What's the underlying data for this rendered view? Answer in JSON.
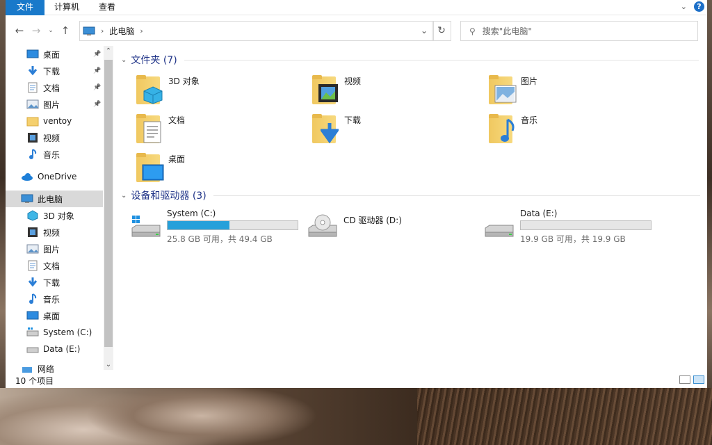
{
  "ribbon": {
    "tabs": [
      "文件",
      "计算机",
      "查看"
    ]
  },
  "address": {
    "location": "此电脑",
    "search_placeholder": "搜索\"此电脑\""
  },
  "nav": {
    "quick": [
      {
        "label": "桌面",
        "icon": "desktop-icon",
        "pinned": true
      },
      {
        "label": "下载",
        "icon": "download-icon",
        "pinned": true
      },
      {
        "label": "文档",
        "icon": "document-icon",
        "pinned": true
      },
      {
        "label": "图片",
        "icon": "picture-icon",
        "pinned": true
      },
      {
        "label": "ventoy",
        "icon": "folder-icon",
        "pinned": false
      },
      {
        "label": "视频",
        "icon": "video-icon",
        "pinned": false
      },
      {
        "label": "音乐",
        "icon": "music-icon",
        "pinned": false
      }
    ],
    "onedrive": "OneDrive",
    "thispc": "此电脑",
    "pc_children": [
      {
        "label": "3D 对象",
        "icon": "3d-objects-icon"
      },
      {
        "label": "视频",
        "icon": "video-icon"
      },
      {
        "label": "图片",
        "icon": "picture-icon"
      },
      {
        "label": "文档",
        "icon": "document-icon"
      },
      {
        "label": "下载",
        "icon": "download-icon"
      },
      {
        "label": "音乐",
        "icon": "music-icon"
      },
      {
        "label": "桌面",
        "icon": "desktop-icon"
      },
      {
        "label": "System (C:)",
        "icon": "windows-drive-icon"
      },
      {
        "label": "Data (E:)",
        "icon": "drive-icon"
      }
    ],
    "network": "网络"
  },
  "folders": {
    "heading": "文件夹 (7)",
    "items": [
      {
        "label": "3D 对象",
        "icon": "3d-objects-folder-icon"
      },
      {
        "label": "视频",
        "icon": "video-folder-icon"
      },
      {
        "label": "图片",
        "icon": "picture-folder-icon"
      },
      {
        "label": "文档",
        "icon": "document-folder-icon"
      },
      {
        "label": "下载",
        "icon": "download-folder-icon"
      },
      {
        "label": "音乐",
        "icon": "music-folder-icon"
      },
      {
        "label": "桌面",
        "icon": "desktop-folder-icon"
      }
    ]
  },
  "drives": {
    "heading": "设备和驱动器 (3)",
    "items": [
      {
        "label": "System (C:)",
        "sub": "25.8 GB 可用，共 49.4 GB",
        "used_fraction": 0.478,
        "icon": "windows-drive-icon"
      },
      {
        "label": "CD 驱动器 (D:)",
        "sub": "",
        "used_fraction": null,
        "icon": "cd-drive-icon"
      },
      {
        "label": "Data (E:)",
        "sub": "19.9 GB 可用，共 19.9 GB",
        "used_fraction": 0.0,
        "icon": "drive-icon"
      }
    ]
  },
  "status": {
    "count": "10 个项目"
  },
  "colors": {
    "accent": "#1979ca",
    "bar_fill": "#26a0da",
    "heading": "#1e3287"
  }
}
